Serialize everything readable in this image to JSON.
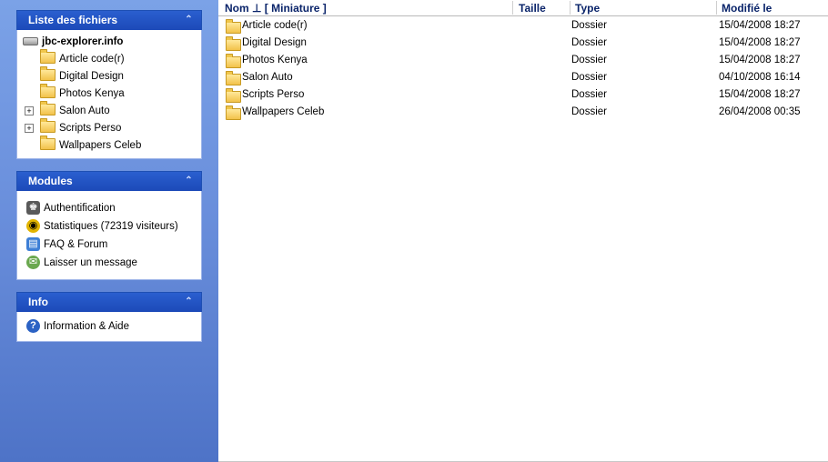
{
  "panels": {
    "files": {
      "title": "Liste des fichiers",
      "root": "jbc-explorer.info",
      "items": [
        {
          "label": "Article code(r)",
          "expandable": false
        },
        {
          "label": "Digital Design",
          "expandable": false
        },
        {
          "label": "Photos Kenya",
          "expandable": false
        },
        {
          "label": "Salon Auto",
          "expandable": true
        },
        {
          "label": "Scripts Perso",
          "expandable": true
        },
        {
          "label": "Wallpapers Celeb",
          "expandable": false
        }
      ]
    },
    "modules": {
      "title": "Modules",
      "items": [
        {
          "label": "Authentification",
          "icon": "authentication-icon"
        },
        {
          "label": "Statistiques (72319 visiteurs)",
          "icon": "statistics-icon"
        },
        {
          "label": "FAQ & Forum",
          "icon": "forum-icon"
        },
        {
          "label": "Laisser un message",
          "icon": "message-icon"
        }
      ]
    },
    "info": {
      "title": "Info",
      "items": [
        {
          "label": "Information & Aide",
          "icon": "help-icon"
        }
      ]
    },
    "collapse_symbol": "⌃"
  },
  "file_list": {
    "columns": {
      "name_prefix": "Nom ⊥",
      "thumbnail": "[ Miniature ]",
      "size": "Taille",
      "type": "Type",
      "modified": "Modifié le"
    },
    "rows": [
      {
        "name": "Article code(r)",
        "size": "",
        "type": "Dossier",
        "modified": "15/04/2008 18:27"
      },
      {
        "name": "Digital Design",
        "size": "",
        "type": "Dossier",
        "modified": "15/04/2008 18:27"
      },
      {
        "name": "Photos Kenya",
        "size": "",
        "type": "Dossier",
        "modified": "15/04/2008 18:27"
      },
      {
        "name": "Salon Auto",
        "size": "",
        "type": "Dossier",
        "modified": "04/10/2008 16:14"
      },
      {
        "name": "Scripts Perso",
        "size": "",
        "type": "Dossier",
        "modified": "15/04/2008 18:27"
      },
      {
        "name": "Wallpapers Celeb",
        "size": "",
        "type": "Dossier",
        "modified": "26/04/2008 00:35"
      }
    ]
  }
}
